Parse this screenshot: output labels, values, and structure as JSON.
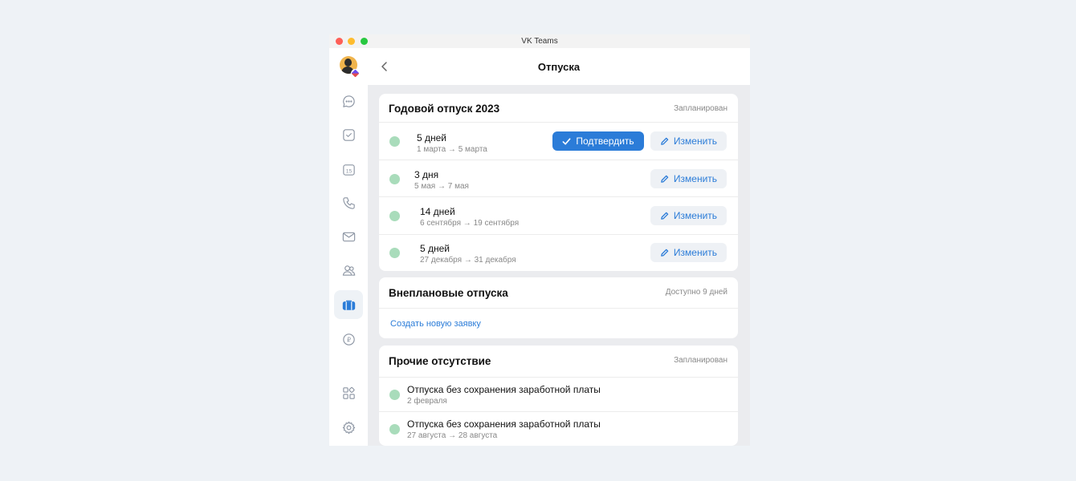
{
  "window": {
    "title": "VK Teams"
  },
  "header": {
    "title": "Отпуска"
  },
  "sidebar": {
    "icons": [
      "chat-icon",
      "tasks-icon",
      "calendar-icon",
      "phone-icon",
      "mail-icon",
      "contacts-icon",
      "vacation-icon",
      "payments-icon",
      "apps-icon",
      "settings-icon"
    ],
    "calendar_day": "15",
    "payments_glyph": "₽"
  },
  "annual": {
    "title": "Годовой отпуск 2023",
    "status": "Запланирован",
    "confirm_label": "Подтвердить",
    "edit_label": "Изменить",
    "items": [
      {
        "days": "5 дней",
        "dates": "1 марта → 5 марта"
      },
      {
        "days": "3 дня",
        "dates": "5 мая → 7 мая"
      },
      {
        "days": "14 дней",
        "dates": "6 сентября → 19 сентября"
      },
      {
        "days": "5 дней",
        "dates": "27 декабря → 31 декабря"
      }
    ]
  },
  "unplanned": {
    "title": "Внеплановые отпуска",
    "status": "Доступно 9 дней",
    "link": "Создать новую заявку"
  },
  "other": {
    "title": "Прочие отсутствие",
    "status": "Запланирован",
    "items": [
      {
        "name": "Отпуска без сохранения заработной платы",
        "dates": "2 февраля"
      },
      {
        "name": "Отпуска без сохранения заработной платы",
        "dates": "27 августа → 28 августа"
      }
    ]
  },
  "colors": {
    "accent": "#2b7cd8",
    "status_dot": "#a9dcbb",
    "background": "#eef2f6"
  }
}
